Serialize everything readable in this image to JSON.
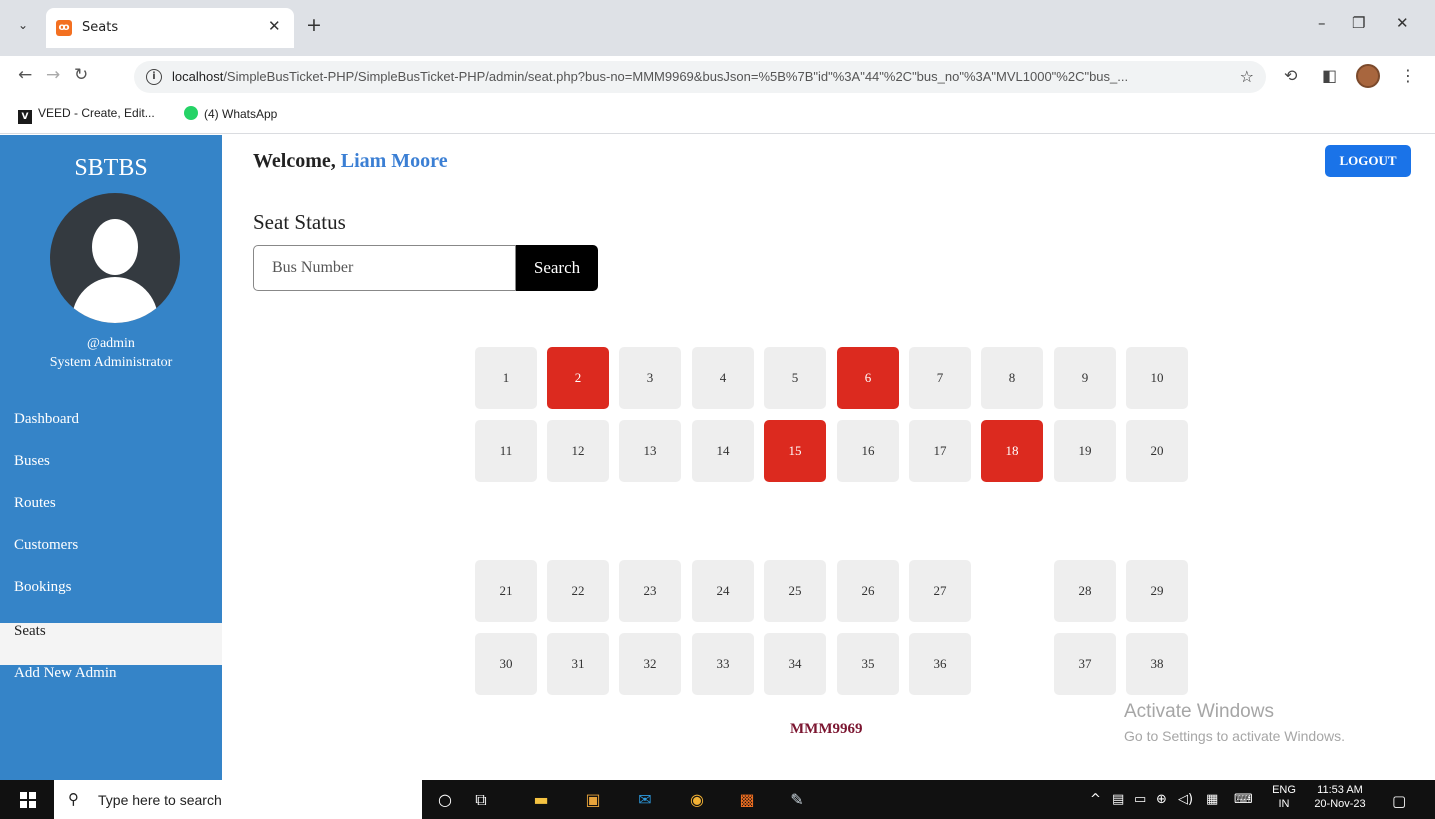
{
  "browser": {
    "tab_title": "Seats",
    "favicon_letter": "ߒ",
    "url_host": "localhost",
    "url_path": "/SimpleBusTicket-PHP/SimpleBusTicket-PHP/admin/seat.php?bus-no=MMM9969&busJson=%5B%7B\"id\"%3A\"44\"%2C\"bus_no\"%3A\"MVL1000\"%2C\"bus_...",
    "bookmarks": [
      {
        "label": "VEED - Create, Edit..."
      },
      {
        "label": "(4) WhatsApp"
      }
    ]
  },
  "sidebar": {
    "brand": "SBTBS",
    "user_handle": "@admin",
    "user_role": "System Administrator",
    "nav": [
      {
        "label": "Dashboard"
      },
      {
        "label": "Buses"
      },
      {
        "label": "Routes"
      },
      {
        "label": "Customers"
      },
      {
        "label": "Bookings"
      },
      {
        "label": "Seats",
        "active": true
      },
      {
        "label": "Add New Admin"
      }
    ]
  },
  "header": {
    "welcome_prefix": "Welcome,",
    "user_name": "Liam Moore",
    "logout_label": "LOGOUT"
  },
  "main": {
    "section_title": "Seat Status",
    "search": {
      "placeholder": "Bus Number",
      "value": "",
      "button_label": "Search"
    },
    "bus_number": "MMM9969",
    "colors": {
      "available": "#eeeeee",
      "booked": "#dc2a1f"
    },
    "seats": [
      {
        "number": "1",
        "booked": false
      },
      {
        "number": "2",
        "booked": true
      },
      {
        "number": "3",
        "booked": false
      },
      {
        "number": "4",
        "booked": false
      },
      {
        "number": "5",
        "booked": false
      },
      {
        "number": "6",
        "booked": true
      },
      {
        "number": "7",
        "booked": false
      },
      {
        "number": "8",
        "booked": false
      },
      {
        "number": "9",
        "booked": false
      },
      {
        "number": "10",
        "booked": false
      },
      {
        "number": "11",
        "booked": false
      },
      {
        "number": "12",
        "booked": false
      },
      {
        "number": "13",
        "booked": false
      },
      {
        "number": "14",
        "booked": false
      },
      {
        "number": "15",
        "booked": true
      },
      {
        "number": "16",
        "booked": false
      },
      {
        "number": "17",
        "booked": false
      },
      {
        "number": "18",
        "booked": true
      },
      {
        "number": "19",
        "booked": false
      },
      {
        "number": "20",
        "booked": false
      },
      {
        "number": "21",
        "booked": false
      },
      {
        "number": "22",
        "booked": false
      },
      {
        "number": "23",
        "booked": false
      },
      {
        "number": "24",
        "booked": false
      },
      {
        "number": "25",
        "booked": false
      },
      {
        "number": "26",
        "booked": false
      },
      {
        "number": "27",
        "booked": false
      },
      {
        "number": "28",
        "booked": false
      },
      {
        "number": "29",
        "booked": false
      },
      {
        "number": "30",
        "booked": false
      },
      {
        "number": "31",
        "booked": false
      },
      {
        "number": "32",
        "booked": false
      },
      {
        "number": "33",
        "booked": false
      },
      {
        "number": "34",
        "booked": false
      },
      {
        "number": "35",
        "booked": false
      },
      {
        "number": "36",
        "booked": false
      },
      {
        "number": "37",
        "booked": false
      },
      {
        "number": "38",
        "booked": false
      }
    ]
  },
  "watermark": {
    "line1": "Activate Windows",
    "line2": "Go to Settings to activate Windows."
  },
  "taskbar": {
    "search_placeholder": "Type here to search",
    "lang_line1": "ENG",
    "lang_line2": "IN",
    "time": "11:53 AM",
    "date": "20-Nov-23"
  }
}
